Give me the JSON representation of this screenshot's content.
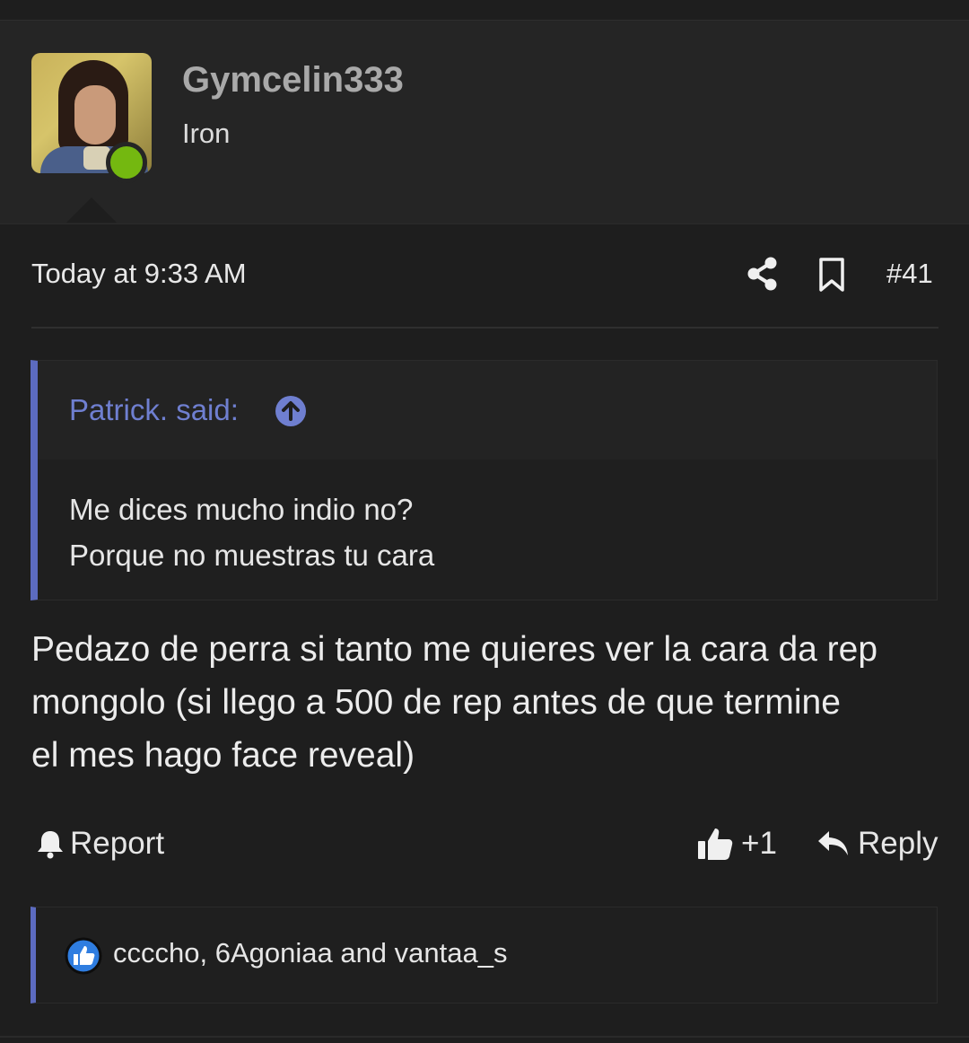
{
  "user": {
    "name": "Gymcelin333",
    "title": "Iron",
    "online": true
  },
  "meta": {
    "date": "Today at 9:33 AM",
    "post_number": "#41",
    "share_icon": "share-icon",
    "bookmark_icon": "bookmark-icon"
  },
  "quote": {
    "author_said": "Patrick. said:",
    "lines": [
      "Me dices mucho indio no?",
      "Porque no muestras tu cara"
    ]
  },
  "message": {
    "lines": [
      "Pedazo de perra si tanto me quieres ver la cara da rep",
      "mongolo (si llego a 500 de rep antes de que termine",
      "el mes hago face reveal)"
    ]
  },
  "actions": {
    "report": "Report",
    "like_count": "+1",
    "reply": "Reply"
  },
  "reactions": {
    "users": "ccccho, 6Agoniaa and vantaa_s"
  },
  "colors": {
    "accent": "#5c6bc0",
    "online": "#74b810",
    "username": "#a9a9a9"
  }
}
